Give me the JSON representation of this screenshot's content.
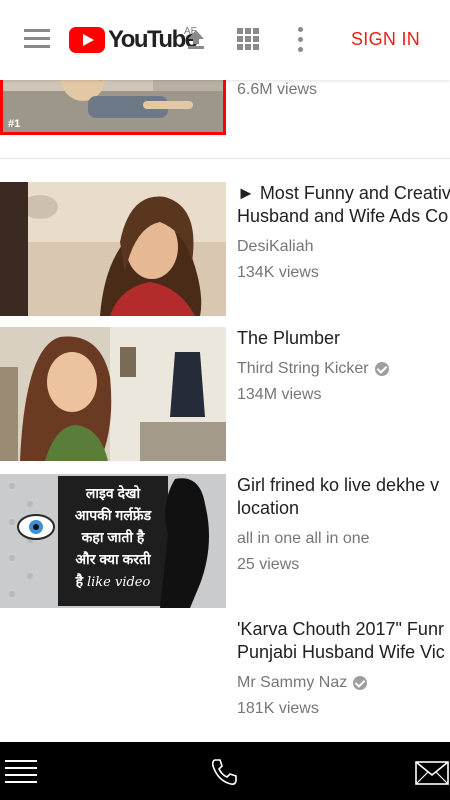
{
  "header": {
    "logo_text": "YouTube",
    "region_label": "AE",
    "signin_label": "SIGN IN",
    "icons": [
      "menu-icon",
      "youtube-logo",
      "upload-icon",
      "apps-icon",
      "more-vert-icon"
    ],
    "accent_color": "#e62117"
  },
  "videos": [
    {
      "title": "",
      "channel": "",
      "views": "6.6M views",
      "rank_badge": "#1",
      "verified": false
    },
    {
      "title": "► Most Funny and Creative",
      "title_line2": "Husband and Wife Ads Co",
      "channel": "DesiKaliah",
      "views": "134K views",
      "verified": false
    },
    {
      "title": "The Plumber",
      "channel": "Third String Kicker",
      "views": "134M views",
      "verified": true
    },
    {
      "title": "Girl frined ko live dekhe v",
      "title_line2": "location",
      "channel": "all in one all in one",
      "views": "25 views",
      "verified": false,
      "thumb_text": [
        "लाइव देखो",
        "आपकी गर्लफ्रेंड",
        "कहा जाती है",
        "और क्या करती",
        "है"
      ],
      "thumb_caption": "like video"
    },
    {
      "title": "'Karva Chouth 2017\" Funr",
      "title_line2": "Punjabi Husband Wife Vic",
      "channel": "Mr Sammy Naz",
      "views": "181K views",
      "verified": true
    }
  ],
  "bottom_bar": {
    "icons": [
      "menu-icon",
      "phone-icon",
      "mail-icon"
    ]
  }
}
